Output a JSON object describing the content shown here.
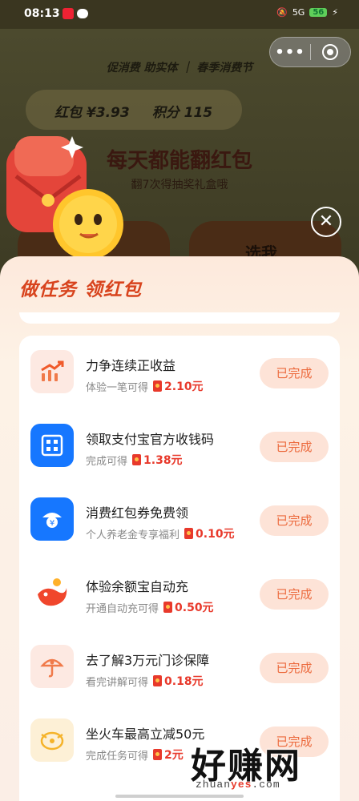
{
  "status_bar": {
    "time": "08:13",
    "network": "5G",
    "battery": "56"
  },
  "background": {
    "tags": "促消费 助实体 ｜ 春季消费节",
    "balance_hongbao": "红包 ¥3.93",
    "balance_points": "积分 115",
    "headline": "每天都能翻红包",
    "subline": "翻7次得抽奖礼盒哦",
    "pick_label": "选我"
  },
  "capsule": {
    "more": "•••"
  },
  "close": "✕",
  "sheet": {
    "title": "做任务 领红包",
    "tasks": [
      {
        "title": "力争连续正收益",
        "desc": "体验一笔可得",
        "amount": "2.10元",
        "button": "已完成",
        "icon": "chart-up-icon"
      },
      {
        "title": "领取支付宝官方收钱码",
        "desc": "完成可得",
        "amount": "1.38元",
        "button": "已完成",
        "icon": "qr-code-icon"
      },
      {
        "title": "消费红包券免费领",
        "desc": "个人养老金专享福利",
        "amount": "0.10元",
        "button": "已完成",
        "icon": "pension-icon"
      },
      {
        "title": "体验余额宝自动充",
        "desc": "开通自动充可得",
        "amount": "0.50元",
        "button": "已完成",
        "icon": "yuebao-icon"
      },
      {
        "title": "去了解3万元门诊保障",
        "desc": "看完讲解可得",
        "amount": "0.18元",
        "button": "已完成",
        "icon": "umbrella-icon"
      },
      {
        "title": "坐火车最高立减50元",
        "desc": "完成任务可得",
        "amount": "2元",
        "button": "已完成",
        "icon": "train-coupon-icon"
      }
    ]
  },
  "watermark": {
    "big": "好赚网",
    "small_a": "zhuan",
    "small_b": "yes",
    "small_c": ".com"
  },
  "colors": {
    "accent": "#e8392b",
    "button_bg": "#fde3d7",
    "button_text": "#ec6a3d",
    "title": "#d8431d"
  }
}
